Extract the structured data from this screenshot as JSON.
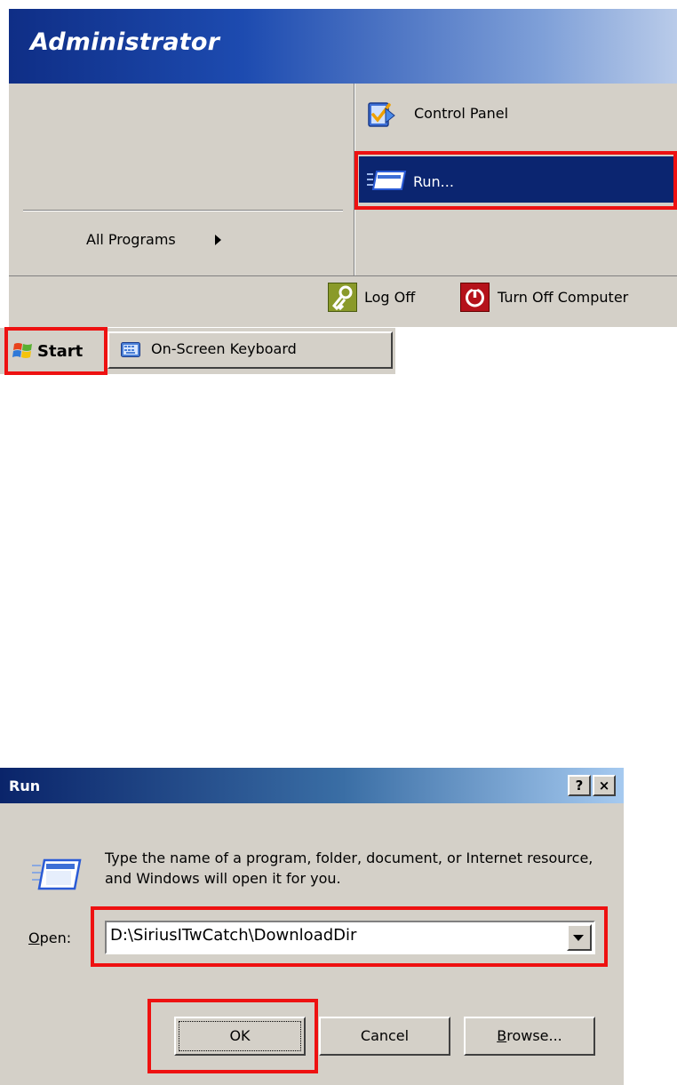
{
  "start_menu": {
    "user_name": "Administrator",
    "all_programs_label": "All Programs",
    "right_items": [
      {
        "label": "Control Panel",
        "icon": "control-panel-icon"
      },
      {
        "label": "Run...",
        "icon": "run-icon",
        "highlighted": true
      }
    ],
    "footer": {
      "log_off_label": "Log Off",
      "turn_off_label": "Turn Off Computer"
    },
    "colors": {
      "header_gradient_start": "#0f2e86",
      "header_gradient_end": "#b9cbe9",
      "highlight": "#0b2570",
      "panel": "#d4d0c8",
      "annotation_red": "#ee1111"
    }
  },
  "taskbar": {
    "start_label": "Start",
    "tasks": [
      {
        "label": "On-Screen Keyboard",
        "icon": "keyboard-icon"
      }
    ]
  },
  "run_dialog": {
    "title": "Run",
    "help_glyph": "?",
    "close_glyph": "×",
    "description": "Type the name of a program, folder, document, or Internet resource, and Windows will open it for you.",
    "open_label_prefix": "O",
    "open_label_rest": "pen:",
    "open_value": "D:\\SiriusITwCatch\\DownloadDir",
    "ok_label": "OK",
    "cancel_label": "Cancel",
    "browse_label_prefix": "B",
    "browse_label_rest": "rowse..."
  }
}
